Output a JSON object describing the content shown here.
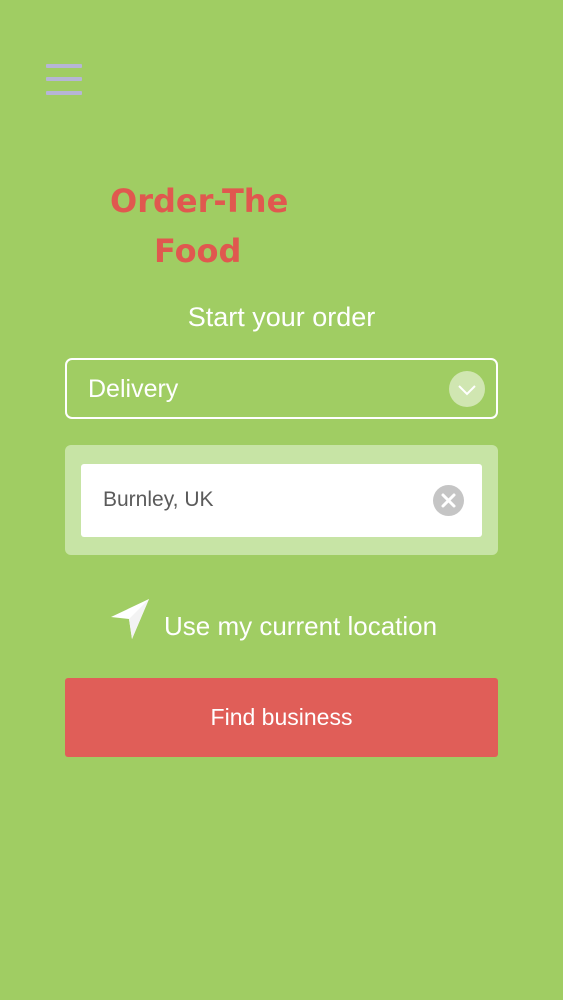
{
  "menu": {
    "icon": "hamburger-menu-icon"
  },
  "logo": {
    "line1": "Order-The",
    "line2": "Food",
    "accent_color": "#e0584f"
  },
  "heading": "Start your order",
  "order_type": {
    "selected": "Delivery",
    "icon": "chevron-down-icon"
  },
  "location_search": {
    "value": "Burnley, UK",
    "clear_icon": "clear-x-icon"
  },
  "current_location": {
    "label": "Use my current location",
    "icon": "location-arrow-icon"
  },
  "find_button": {
    "label": "Find business",
    "color": "#e05e58"
  },
  "colors": {
    "background": "#a0cd63",
    "text": "#ffffff"
  }
}
